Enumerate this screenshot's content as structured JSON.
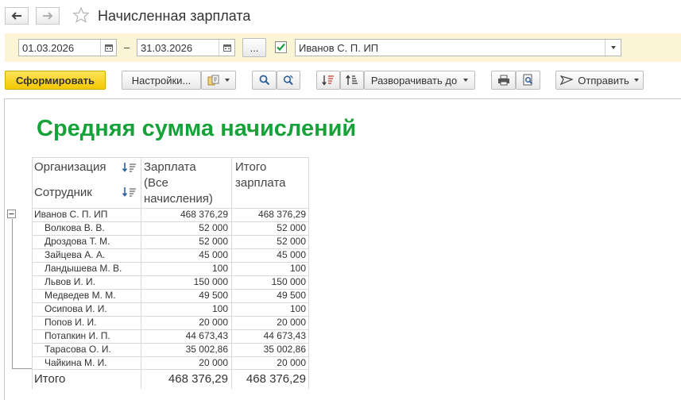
{
  "window": {
    "title": "Начисленная зарплата"
  },
  "period": {
    "date_from": "01.03.2026",
    "dash": "–",
    "date_to": "31.03.2026",
    "ellipsis": "...",
    "org_checked": true,
    "organization": "Иванов С. П. ИП"
  },
  "toolbar": {
    "generate": "Сформировать",
    "settings": "Настройки...",
    "expand_to": "Разворачивать до",
    "send": "Отправить"
  },
  "report": {
    "title": "Средняя сумма начислений",
    "headers": {
      "organization": "Организация",
      "employee": "Сотрудник",
      "salary_line1": "Зарплата",
      "salary_line2": "(Все",
      "salary_line3": "начисления)",
      "total_line1": "Итого",
      "total_line2": "зарплата"
    },
    "rows": [
      {
        "name": "Иванов С. П. ИП",
        "salary": "468 376,29",
        "total": "468 376,29"
      },
      {
        "name": "Волкова В. В.",
        "salary": "52 000",
        "total": "52 000"
      },
      {
        "name": "Дроздова Т. М.",
        "salary": "52 000",
        "total": "52 000"
      },
      {
        "name": "Зайцева А. А.",
        "salary": "45 000",
        "total": "45 000"
      },
      {
        "name": "Ландышева М. В.",
        "salary": "100",
        "total": "100"
      },
      {
        "name": "Львов И. И.",
        "salary": "150 000",
        "total": "150 000"
      },
      {
        "name": "Медведев М. М.",
        "salary": "49 500",
        "total": "49 500"
      },
      {
        "name": "Осипова И. И.",
        "salary": "100",
        "total": "100"
      },
      {
        "name": "Попов И. И.",
        "salary": "20 000",
        "total": "20 000"
      },
      {
        "name": "Потапкин И. П.",
        "salary": "44 673,43",
        "total": "44 673,43"
      },
      {
        "name": "Тарасова О. И.",
        "salary": "35 002,86",
        "total": "35 002,86"
      },
      {
        "name": "Чайкина М. И.",
        "salary": "20 000",
        "total": "20 000"
      }
    ],
    "grand_total": {
      "label": "Итого",
      "salary": "468 376,29",
      "total": "468 376,29"
    }
  },
  "colors": {
    "accent_green": "#15a339",
    "primary_button": "#f4c800",
    "panel_bg": "#fbf5d6"
  },
  "icons": [
    "arrow-left-icon",
    "arrow-right-icon",
    "star-icon",
    "calendar-icon",
    "checkbox-icon",
    "dropdown-icon",
    "copy-options-icon",
    "search-icon",
    "search-next-icon",
    "sort-descending-icon",
    "sort-ascending-icon",
    "print-icon",
    "preview-icon",
    "send-icon",
    "collapse-icon"
  ]
}
